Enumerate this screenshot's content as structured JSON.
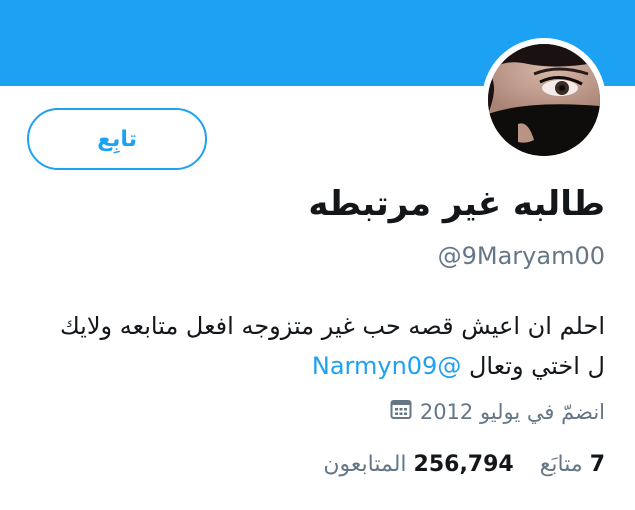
{
  "profile": {
    "display_name": "طالبه غير مرتبطه",
    "handle": "@9Maryam00",
    "bio_text": "احلم ان اعيش قصه حب غير متزوجه افعل متابعه ولايك ل اختي وتعال",
    "bio_mention": "@Narmyn09",
    "joined": "انضمّ في يوليو 2012",
    "avatar_icon": "profile-photo"
  },
  "actions": {
    "follow_label": "تابِع"
  },
  "stats": {
    "following_count": "7",
    "following_label": "متابَع",
    "followers_count": "256,794",
    "followers_label": "المتابعون"
  },
  "colors": {
    "accent": "#1da1f2",
    "secondary_text": "#657786",
    "primary_text": "#14171a"
  }
}
